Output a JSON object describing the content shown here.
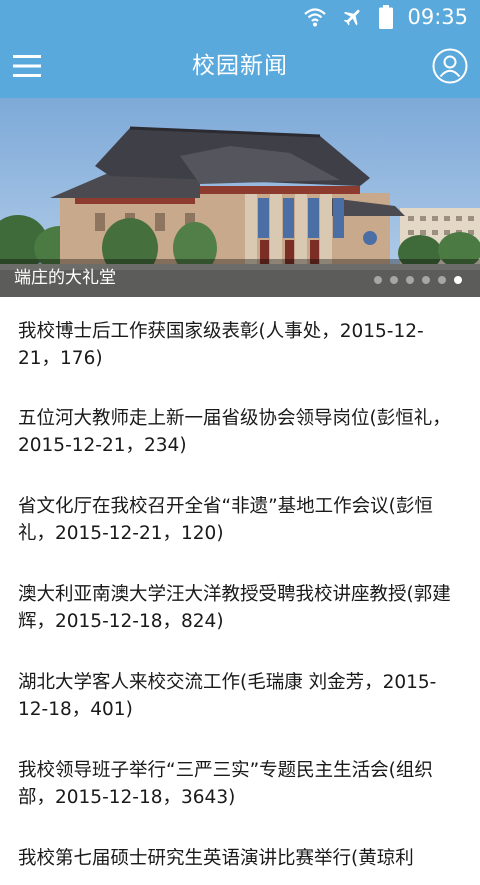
{
  "status_bar": {
    "time": "09:35",
    "icons": [
      "wifi-icon",
      "airplane-icon",
      "battery-icon"
    ]
  },
  "app_bar": {
    "title": "校园新闻",
    "menu_icon": "menu-icon",
    "user_icon": "user-icon"
  },
  "banner": {
    "caption": "端庄的大礼堂",
    "slide_count": 6,
    "active_slide": 6
  },
  "news": [
    {
      "text": "我校博士后工作获国家级表彰(人事处，2015-12-21，176)"
    },
    {
      "text": "五位河大教师走上新一届省级协会领导岗位(彭恒礼，2015-12-21，234)"
    },
    {
      "text": "省文化厅在我校召开全省“非遗”基地工作会议(彭恒礼，2015-12-21，120)"
    },
    {
      "text": "澳大利亚南澳大学汪大洋教授受聘我校讲座教授(郭建辉，2015-12-18，824)"
    },
    {
      "text": "湖北大学客人来校交流工作(毛瑞康 刘金芳，2015-12-18，401)"
    },
    {
      "text": "我校领导班子举行“三严三实”专题民主生活会(组织部，2015-12-18，3643)"
    },
    {
      "text": "我校第七届硕士研究生英语演讲比赛举行(黄琼利"
    }
  ],
  "colors": {
    "primary": "#5aa9dd",
    "text": "#1a1a1a"
  }
}
